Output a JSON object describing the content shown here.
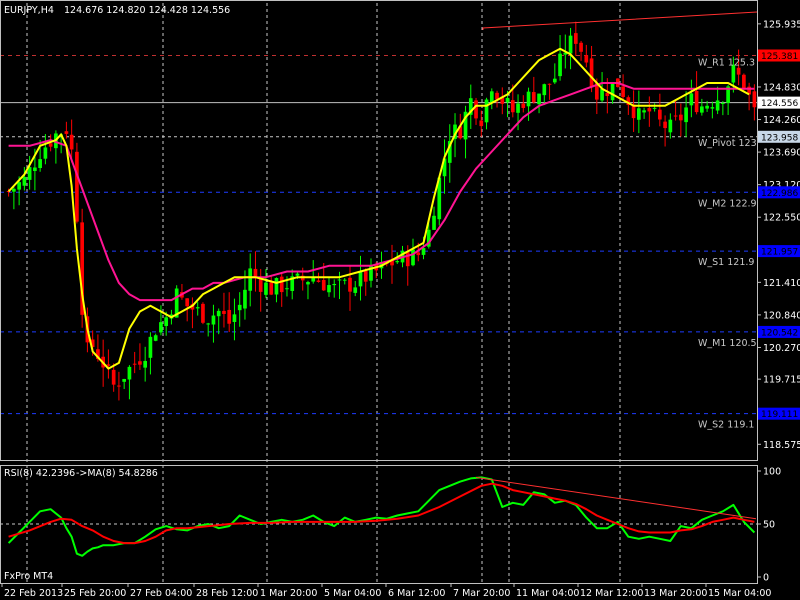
{
  "header": {
    "symbol": "EURJPY,H4",
    "ohlc": "124.676 124.820 124.428 124.556",
    "rsi_label": "RSI(8) 42.2396",
    "rsi_ma_label": "->MA(8) 54.8286",
    "broker": "FxPro MT4"
  },
  "colors": {
    "bull": "#00ff00",
    "bear": "#ff0000",
    "fast_ma": "#ffff00",
    "slow_ma": "#ff1493",
    "pivot_line": "#1e3cff",
    "resistance_line": "#ff3030",
    "rsi_line": "#00ff00",
    "rsi_ma": "#ff0000"
  },
  "chart_data": [
    {
      "type": "candlestick",
      "ylim": [
        118.3,
        126.3
      ],
      "y_ticks": [
        125.935,
        124.83,
        124.26,
        123.69,
        123.12,
        122.55,
        121.975,
        121.41,
        120.84,
        120.27,
        119.715,
        118.575
      ],
      "x_ticks": [
        "22 Feb 2013",
        "25 Feb 20:00",
        "27 Feb 04:00",
        "28 Feb 12:00",
        "1 Mar 20:00",
        "5 Mar 04:00",
        "6 Mar 12:00",
        "7 Mar 20:00",
        "11 Mar 04:00",
        "12 Mar 12:00",
        "13 Mar 20:00",
        "15 Mar 04:00"
      ],
      "price_tags": [
        {
          "value": 125.381,
          "label": "125.381",
          "color": "#ff0000"
        },
        {
          "value": 124.556,
          "label": "124.556",
          "color": "#ffffff"
        },
        {
          "value": 123.958,
          "label": "123.958",
          "color": "#ffffff"
        },
        {
          "value": 122.986,
          "label": "122.986",
          "color": "#0000ff"
        },
        {
          "value": 121.957,
          "label": "121.957",
          "color": "#0000ff"
        },
        {
          "value": 120.542,
          "label": "120.542",
          "color": "#0000ff"
        },
        {
          "value": 119.111,
          "label": "119.111",
          "color": "#0000ff"
        }
      ],
      "pivots": [
        {
          "name": "W_R1",
          "label": "W_R1 125.3",
          "value": 125.381
        },
        {
          "name": "W_Pivot",
          "label": "W_Pivot 123",
          "value": 123.958
        },
        {
          "name": "W_M2",
          "label": "W_M2 122.9",
          "value": 122.986
        },
        {
          "name": "W_S1",
          "label": "W_S1 121.9",
          "value": 121.957
        },
        {
          "name": "W_M1",
          "label": "W_M1 120.5",
          "value": 120.542
        },
        {
          "name": "W_S2",
          "label": "W_S2 119.1",
          "value": 119.111
        }
      ],
      "close_path": [
        [
          0,
          123.0
        ],
        [
          3,
          123.2
        ],
        [
          6,
          123.7
        ],
        [
          9,
          124.0
        ],
        [
          11,
          124.1
        ],
        [
          12,
          123.7
        ],
        [
          13,
          122.6
        ],
        [
          14,
          121.0
        ],
        [
          15,
          120.2
        ],
        [
          16,
          120.3
        ],
        [
          18,
          120.0
        ],
        [
          20,
          119.6
        ],
        [
          22,
          119.8
        ],
        [
          24,
          120.0
        ],
        [
          26,
          120.2
        ],
        [
          28,
          120.6
        ],
        [
          30,
          120.8
        ],
        [
          32,
          121.2
        ],
        [
          34,
          121.0
        ],
        [
          36,
          120.9
        ],
        [
          38,
          120.8
        ],
        [
          40,
          120.9
        ],
        [
          42,
          120.7
        ],
        [
          44,
          121.0
        ],
        [
          46,
          121.6
        ],
        [
          48,
          121.4
        ],
        [
          50,
          121.3
        ],
        [
          54,
          121.4
        ],
        [
          58,
          121.5
        ],
        [
          62,
          121.3
        ],
        [
          66,
          121.4
        ],
        [
          70,
          121.6
        ],
        [
          74,
          121.8
        ],
        [
          78,
          121.9
        ],
        [
          80,
          122.3
        ],
        [
          82,
          123.2
        ],
        [
          84,
          124.0
        ],
        [
          86,
          124.1
        ],
        [
          88,
          124.6
        ],
        [
          90,
          124.3
        ],
        [
          92,
          124.9
        ],
        [
          94,
          124.6
        ],
        [
          96,
          124.4
        ],
        [
          98,
          124.6
        ],
        [
          100,
          124.7
        ],
        [
          102,
          124.8
        ],
        [
          104,
          125.0
        ],
        [
          106,
          125.5
        ],
        [
          108,
          125.7
        ],
        [
          110,
          125.3
        ],
        [
          112,
          124.7
        ],
        [
          114,
          124.8
        ],
        [
          116,
          124.9
        ],
        [
          118,
          124.6
        ],
        [
          120,
          124.3
        ],
        [
          122,
          124.4
        ],
        [
          124,
          124.2
        ],
        [
          126,
          124.1
        ],
        [
          128,
          124.3
        ],
        [
          130,
          124.6
        ],
        [
          132,
          124.5
        ],
        [
          134,
          124.6
        ],
        [
          136,
          124.7
        ],
        [
          138,
          125.1
        ],
        [
          140,
          124.9
        ],
        [
          142,
          124.4
        ]
      ],
      "fast_ma": [
        [
          0,
          123.0
        ],
        [
          3,
          123.3
        ],
        [
          6,
          123.8
        ],
        [
          9,
          123.9
        ],
        [
          10,
          124.0
        ],
        [
          11,
          123.8
        ],
        [
          12,
          123.1
        ],
        [
          13,
          122.0
        ],
        [
          14,
          121.2
        ],
        [
          15,
          120.6
        ],
        [
          16,
          120.2
        ],
        [
          17,
          120.1
        ],
        [
          19,
          119.9
        ],
        [
          21,
          120.0
        ],
        [
          23,
          120.6
        ],
        [
          25,
          120.9
        ],
        [
          27,
          121.0
        ],
        [
          29,
          120.9
        ],
        [
          31,
          120.8
        ],
        [
          33,
          120.9
        ],
        [
          35,
          121.0
        ],
        [
          37,
          121.2
        ],
        [
          39,
          121.3
        ],
        [
          41,
          121.4
        ],
        [
          43,
          121.5
        ],
        [
          47,
          121.5
        ],
        [
          51,
          121.4
        ],
        [
          55,
          121.5
        ],
        [
          59,
          121.5
        ],
        [
          63,
          121.5
        ],
        [
          67,
          121.6
        ],
        [
          71,
          121.7
        ],
        [
          75,
          121.9
        ],
        [
          79,
          122.1
        ],
        [
          81,
          122.9
        ],
        [
          83,
          123.6
        ],
        [
          85,
          124.0
        ],
        [
          87,
          124.3
        ],
        [
          89,
          124.5
        ],
        [
          91,
          124.5
        ],
        [
          93,
          124.6
        ],
        [
          95,
          124.7
        ],
        [
          97,
          124.9
        ],
        [
          99,
          125.1
        ],
        [
          101,
          125.3
        ],
        [
          103,
          125.4
        ],
        [
          105,
          125.5
        ],
        [
          107,
          125.4
        ],
        [
          109,
          125.2
        ],
        [
          111,
          125.0
        ],
        [
          113,
          124.8
        ],
        [
          115,
          124.7
        ],
        [
          117,
          124.6
        ],
        [
          119,
          124.5
        ],
        [
          121,
          124.5
        ],
        [
          123,
          124.5
        ],
        [
          125,
          124.5
        ],
        [
          127,
          124.6
        ],
        [
          129,
          124.7
        ],
        [
          131,
          124.8
        ],
        [
          133,
          124.9
        ],
        [
          135,
          124.9
        ],
        [
          137,
          124.9
        ],
        [
          139,
          124.8
        ],
        [
          141,
          124.7
        ]
      ],
      "slow_ma": [
        [
          0,
          123.8
        ],
        [
          4,
          123.8
        ],
        [
          8,
          123.9
        ],
        [
          11,
          123.8
        ],
        [
          13,
          123.3
        ],
        [
          15,
          122.8
        ],
        [
          17,
          122.3
        ],
        [
          19,
          121.8
        ],
        [
          21,
          121.4
        ],
        [
          23,
          121.2
        ],
        [
          25,
          121.1
        ],
        [
          27,
          121.1
        ],
        [
          29,
          121.1
        ],
        [
          31,
          121.1
        ],
        [
          33,
          121.2
        ],
        [
          35,
          121.3
        ],
        [
          37,
          121.3
        ],
        [
          39,
          121.4
        ],
        [
          41,
          121.4
        ],
        [
          45,
          121.5
        ],
        [
          49,
          121.5
        ],
        [
          53,
          121.6
        ],
        [
          57,
          121.6
        ],
        [
          61,
          121.7
        ],
        [
          65,
          121.7
        ],
        [
          69,
          121.7
        ],
        [
          73,
          121.8
        ],
        [
          77,
          121.9
        ],
        [
          80,
          122.1
        ],
        [
          83,
          122.5
        ],
        [
          86,
          123.0
        ],
        [
          89,
          123.4
        ],
        [
          92,
          123.7
        ],
        [
          95,
          124.0
        ],
        [
          98,
          124.3
        ],
        [
          101,
          124.5
        ],
        [
          104,
          124.6
        ],
        [
          107,
          124.7
        ],
        [
          110,
          124.8
        ],
        [
          113,
          124.9
        ],
        [
          116,
          124.9
        ],
        [
          119,
          124.8
        ],
        [
          122,
          124.8
        ],
        [
          125,
          124.8
        ],
        [
          128,
          124.8
        ],
        [
          131,
          124.8
        ],
        [
          134,
          124.8
        ],
        [
          137,
          124.8
        ],
        [
          140,
          124.8
        ],
        [
          142,
          124.8
        ]
      ]
    },
    {
      "type": "line",
      "ylim": [
        0,
        100
      ],
      "y_ticks": [
        100,
        50,
        0
      ],
      "rsi": [
        [
          0,
          32
        ],
        [
          2,
          42
        ],
        [
          4,
          52
        ],
        [
          6,
          62
        ],
        [
          8,
          64
        ],
        [
          10,
          56
        ],
        [
          11,
          46
        ],
        [
          12,
          38
        ],
        [
          13,
          22
        ],
        [
          14,
          20
        ],
        [
          15,
          24
        ],
        [
          16,
          27
        ],
        [
          17,
          28
        ],
        [
          18,
          30
        ],
        [
          20,
          30
        ],
        [
          22,
          32
        ],
        [
          24,
          32
        ],
        [
          26,
          38
        ],
        [
          28,
          45
        ],
        [
          30,
          48
        ],
        [
          32,
          45
        ],
        [
          34,
          44
        ],
        [
          36,
          48
        ],
        [
          38,
          50
        ],
        [
          40,
          46
        ],
        [
          42,
          48
        ],
        [
          44,
          58
        ],
        [
          46,
          54
        ],
        [
          48,
          50
        ],
        [
          50,
          52
        ],
        [
          52,
          54
        ],
        [
          54,
          52
        ],
        [
          56,
          54
        ],
        [
          58,
          58
        ],
        [
          60,
          52
        ],
        [
          62,
          48
        ],
        [
          64,
          56
        ],
        [
          66,
          52
        ],
        [
          68,
          54
        ],
        [
          70,
          56
        ],
        [
          72,
          55
        ],
        [
          74,
          58
        ],
        [
          76,
          60
        ],
        [
          78,
          62
        ],
        [
          80,
          72
        ],
        [
          82,
          82
        ],
        [
          84,
          86
        ],
        [
          86,
          90
        ],
        [
          88,
          93
        ],
        [
          90,
          94
        ],
        [
          92,
          92
        ],
        [
          94,
          66
        ],
        [
          96,
          70
        ],
        [
          98,
          68
        ],
        [
          100,
          80
        ],
        [
          102,
          78
        ],
        [
          104,
          70
        ],
        [
          106,
          72
        ],
        [
          108,
          68
        ],
        [
          110,
          56
        ],
        [
          112,
          46
        ],
        [
          114,
          46
        ],
        [
          116,
          52
        ],
        [
          118,
          38
        ],
        [
          120,
          36
        ],
        [
          122,
          38
        ],
        [
          124,
          36
        ],
        [
          126,
          34
        ],
        [
          128,
          48
        ],
        [
          130,
          46
        ],
        [
          132,
          54
        ],
        [
          134,
          58
        ],
        [
          136,
          62
        ],
        [
          138,
          68
        ],
        [
          140,
          52
        ],
        [
          142,
          42
        ]
      ],
      "rsi_ma": [
        [
          0,
          38
        ],
        [
          4,
          44
        ],
        [
          8,
          52
        ],
        [
          10,
          55
        ],
        [
          12,
          54
        ],
        [
          14,
          48
        ],
        [
          16,
          44
        ],
        [
          18,
          38
        ],
        [
          20,
          34
        ],
        [
          22,
          32
        ],
        [
          24,
          32
        ],
        [
          26,
          34
        ],
        [
          28,
          38
        ],
        [
          30,
          44
        ],
        [
          32,
          46
        ],
        [
          34,
          46
        ],
        [
          36,
          47
        ],
        [
          38,
          48
        ],
        [
          40,
          49
        ],
        [
          42,
          50
        ],
        [
          46,
          51
        ],
        [
          50,
          51
        ],
        [
          54,
          52
        ],
        [
          58,
          52
        ],
        [
          62,
          52
        ],
        [
          66,
          52
        ],
        [
          70,
          53
        ],
        [
          74,
          55
        ],
        [
          78,
          58
        ],
        [
          82,
          66
        ],
        [
          86,
          76
        ],
        [
          90,
          86
        ],
        [
          92,
          88
        ],
        [
          94,
          86
        ],
        [
          96,
          82
        ],
        [
          98,
          80
        ],
        [
          100,
          78
        ],
        [
          102,
          76
        ],
        [
          104,
          74
        ],
        [
          106,
          72
        ],
        [
          108,
          69
        ],
        [
          110,
          64
        ],
        [
          112,
          58
        ],
        [
          114,
          54
        ],
        [
          116,
          50
        ],
        [
          118,
          46
        ],
        [
          120,
          43
        ],
        [
          122,
          42
        ],
        [
          124,
          42
        ],
        [
          126,
          42
        ],
        [
          128,
          44
        ],
        [
          130,
          45
        ],
        [
          132,
          48
        ],
        [
          134,
          52
        ],
        [
          136,
          54
        ],
        [
          138,
          56
        ],
        [
          140,
          54
        ],
        [
          142,
          52
        ]
      ],
      "levels": [
        50
      ]
    }
  ]
}
